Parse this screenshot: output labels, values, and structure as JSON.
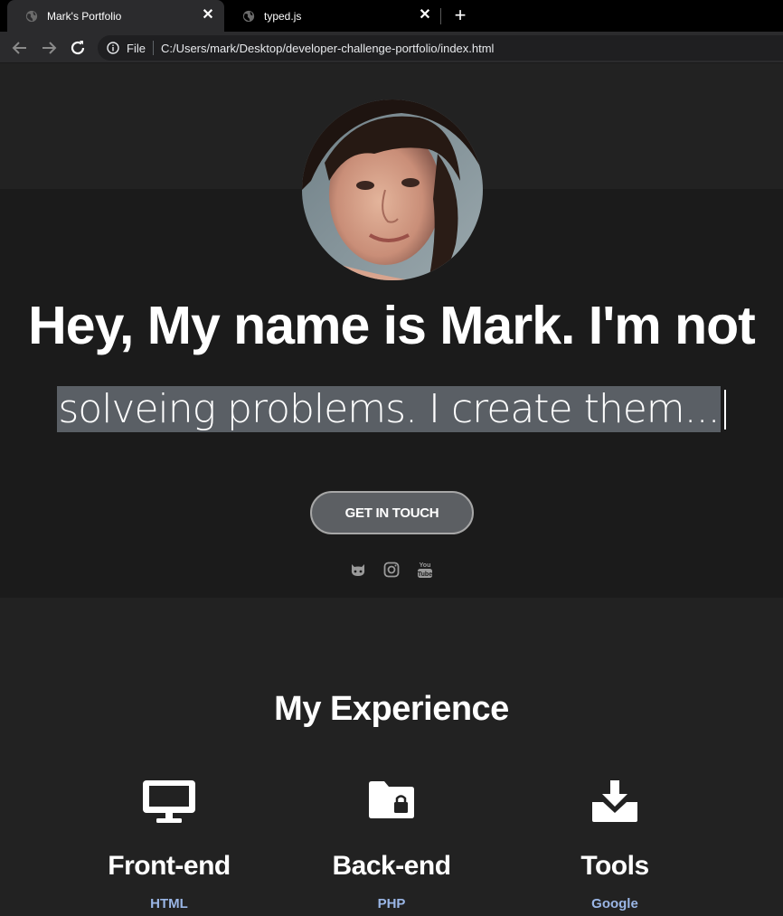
{
  "browser": {
    "tabs": [
      {
        "title": "Mark's Portfolio",
        "active": true
      },
      {
        "title": "typed.js",
        "active": false
      }
    ],
    "address": {
      "scheme_label": "File",
      "url": "C:/Users/mark/Desktop/developer-challenge-portfolio/index.html"
    }
  },
  "hero": {
    "headline": "Hey, My name is Mark. I'm not",
    "typed_text": "solveing problems. I create them...",
    "cta_label": "GET IN TOUCH",
    "socials": [
      {
        "icon": "github-icon"
      },
      {
        "icon": "instagram-icon"
      },
      {
        "icon": "youtube-icon"
      }
    ]
  },
  "experience": {
    "title": "My Experience",
    "columns": [
      {
        "icon": "desktop-icon",
        "heading": "Front-end",
        "sub": "HTML"
      },
      {
        "icon": "folder-lock-icon",
        "heading": "Back-end",
        "sub": "PHP"
      },
      {
        "icon": "download-tray-icon",
        "heading": "Tools",
        "sub": "Google"
      }
    ]
  },
  "colors": {
    "page_bg": "#222222",
    "hero_bg": "#1b1b1b",
    "button_bg": "#5c5f63",
    "link_blue": "#9ab6e6"
  }
}
